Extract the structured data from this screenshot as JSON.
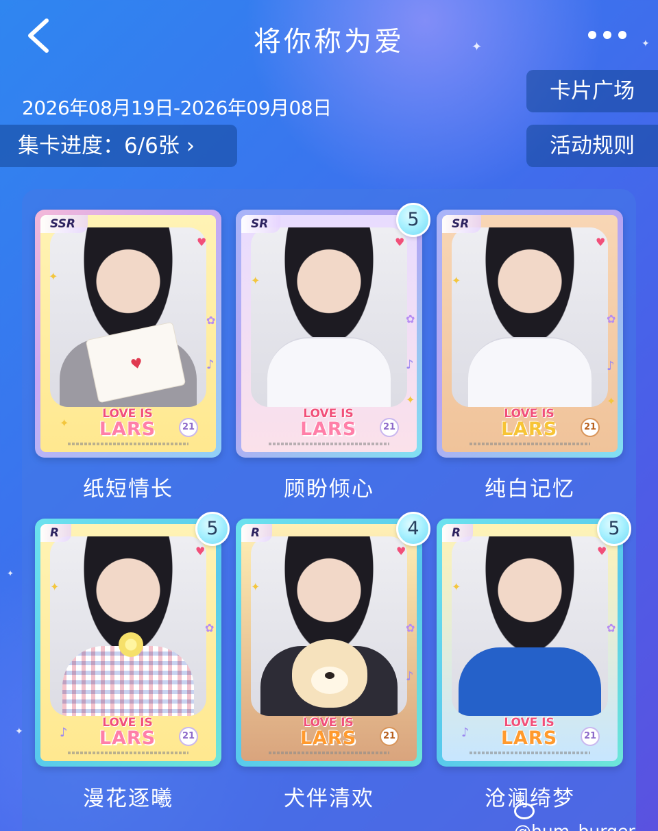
{
  "header": {
    "title": "将你称为爱"
  },
  "event": {
    "date_range": "2026年08月19日-2026年09月08日",
    "progress_label": "集卡进度：6/6张 ›"
  },
  "side_buttons": {
    "card_square": "卡片广场",
    "rules": "活动规则"
  },
  "cards": [
    {
      "name": "纸短情长",
      "tier": "SSR",
      "count": null
    },
    {
      "name": "顾盼倾心",
      "tier": "SR",
      "count": "5"
    },
    {
      "name": "纯白记忆",
      "tier": "SR",
      "count": null
    },
    {
      "name": "漫花逐曦",
      "tier": "R",
      "count": "5"
    },
    {
      "name": "犬伴清欢",
      "tier": "R",
      "count": "4"
    },
    {
      "name": "沧澜绮梦",
      "tier": "R",
      "count": "5"
    }
  ],
  "card_logo": {
    "line1": "LOVE IS",
    "line2": "LARS",
    "badge": "21"
  },
  "watermark": "@hum_burger",
  "icons": {
    "back": "chevron-left-icon",
    "more": "more-dots-icon"
  },
  "colors": {
    "background_top": "#2f86f0",
    "background_bottom": "#5a52e0",
    "button_bg": "#144696",
    "count_badge": "#a9f1ff"
  }
}
